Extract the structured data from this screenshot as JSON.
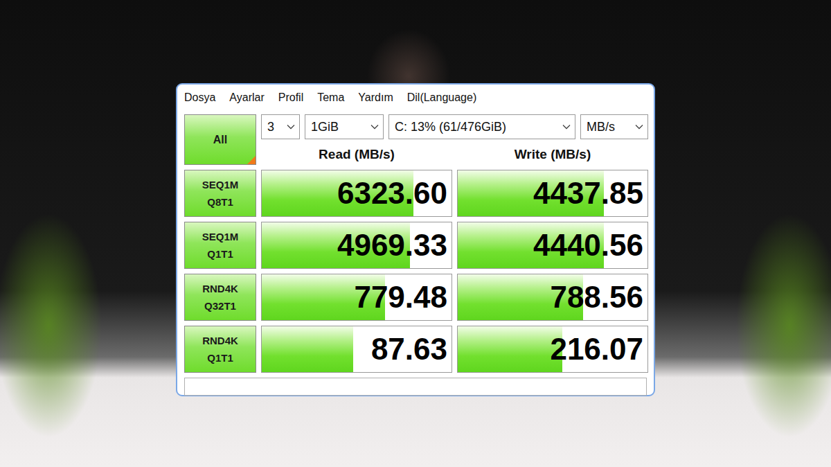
{
  "menu": [
    "Dosya",
    "Ayarlar",
    "Profil",
    "Tema",
    "Yardım",
    "Dil(Language)"
  ],
  "controls": {
    "all_button": "All",
    "count": "3",
    "size": "1GiB",
    "drive": "C: 13% (61/476GiB)",
    "unit": "MB/s"
  },
  "headers": {
    "read": "Read (MB/s)",
    "write": "Write (MB/s)"
  },
  "rows": [
    {
      "test": "SEQ1M",
      "params": "Q8T1",
      "read": {
        "value": "6323.60",
        "level": 0.8
      },
      "write": {
        "value": "4437.85",
        "level": 0.77
      }
    },
    {
      "test": "SEQ1M",
      "params": "Q1T1",
      "read": {
        "value": "4969.33",
        "level": 0.78
      },
      "write": {
        "value": "4440.56",
        "level": 0.77
      }
    },
    {
      "test": "RND4K",
      "params": "Q32T1",
      "read": {
        "value": "779.48",
        "level": 0.65
      },
      "write": {
        "value": "788.56",
        "level": 0.66
      }
    },
    {
      "test": "RND4K",
      "params": "Q1T1",
      "read": {
        "value": "87.63",
        "level": 0.48
      },
      "write": {
        "value": "216.07",
        "level": 0.55
      }
    }
  ],
  "comment": ""
}
